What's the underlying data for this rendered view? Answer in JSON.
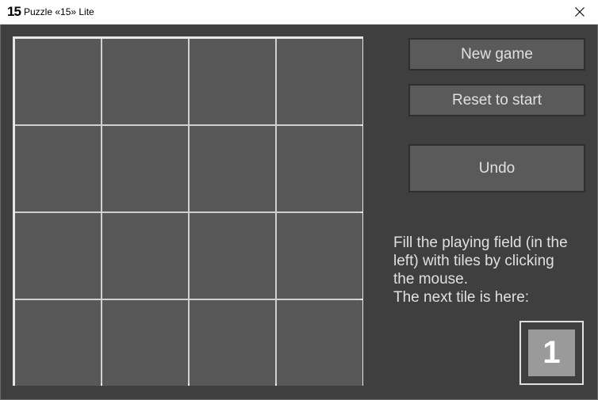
{
  "window": {
    "app_icon": "15",
    "title": "Puzzle «15» Lite",
    "close_icon": "close-x-icon"
  },
  "board": {
    "rows": 4,
    "cols": 4,
    "tiles": [
      null,
      null,
      null,
      null,
      null,
      null,
      null,
      null,
      null,
      null,
      null,
      null,
      null,
      null,
      null,
      null
    ]
  },
  "buttons": {
    "new_game": "New game",
    "reset": "Reset to start",
    "undo": "Undo"
  },
  "info": {
    "line1": "Fill the playing field (in the",
    "line2": "left) with tiles by clicking",
    "line3": "the mouse.",
    "line4": "The next tile is here:"
  },
  "next_tile": {
    "value": "1"
  },
  "colors": {
    "background": "#404040",
    "cell": "#585858",
    "board_border": "#e6e6e6",
    "button": "#5a5a5a",
    "text": "#e0e0e0",
    "next_tile": "#9a9a9a"
  }
}
